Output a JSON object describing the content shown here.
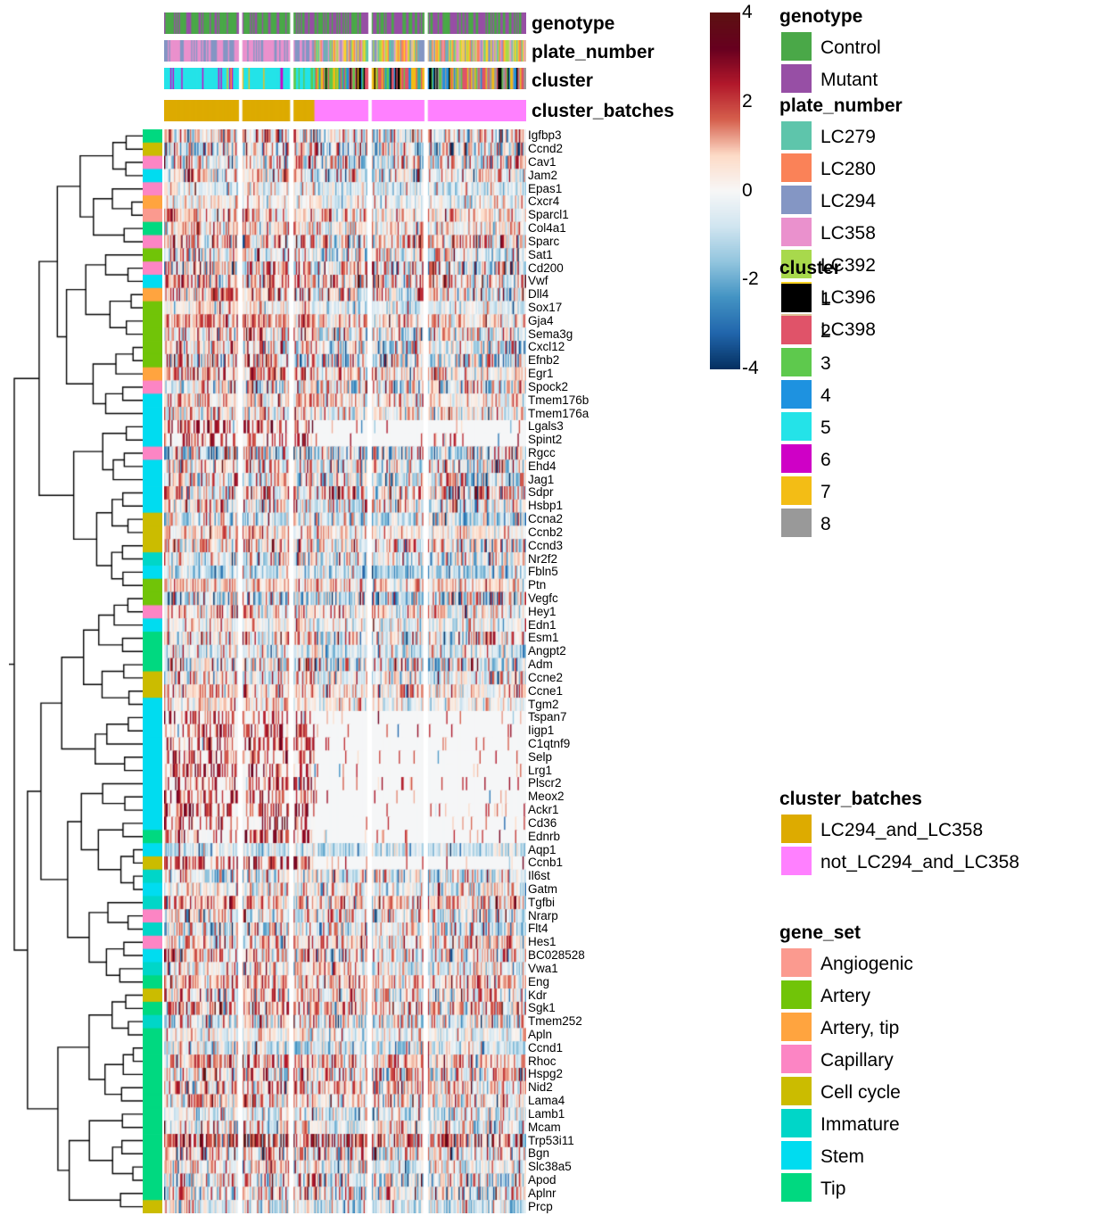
{
  "column_annotations": [
    {
      "name": "genotype",
      "label": "genotype"
    },
    {
      "name": "plate_number",
      "label": "plate_number"
    },
    {
      "name": "cluster",
      "label": "cluster"
    },
    {
      "name": "cluster_batches",
      "label": "cluster_batches"
    }
  ],
  "colorbar": {
    "ticks": [
      "4",
      "2",
      "0",
      "-2",
      "-4"
    ],
    "values": [
      4,
      2,
      0,
      -2,
      -4
    ],
    "low_color": "#053061",
    "mid_color": "#ffffff",
    "high_color": "#5c1111"
  },
  "legends": [
    {
      "title": "genotype",
      "items": [
        {
          "label": "Control",
          "color": "#4aa848"
        },
        {
          "label": "Mutant",
          "color": "#974fa5"
        }
      ]
    },
    {
      "title": "plate_number",
      "items": [
        {
          "label": "LC279",
          "color": "#5ec5ab"
        },
        {
          "label": "LC280",
          "color": "#fa8258"
        },
        {
          "label": "LC294",
          "color": "#8496c4"
        },
        {
          "label": "LC358",
          "color": "#ea91cd"
        },
        {
          "label": "LC392",
          "color": "#a8d94c"
        },
        {
          "label": "LC396",
          "color": "#ffd324"
        },
        {
          "label": "LC398",
          "color": "#e0c296"
        }
      ]
    },
    {
      "title": "cluster",
      "items": [
        {
          "label": "1",
          "color": "#000000"
        },
        {
          "label": "2",
          "color": "#e05369"
        },
        {
          "label": "3",
          "color": "#5ec94d"
        },
        {
          "label": "4",
          "color": "#1e92e0"
        },
        {
          "label": "5",
          "color": "#24e3e8"
        },
        {
          "label": "6",
          "color": "#cf00c6"
        },
        {
          "label": "7",
          "color": "#f3bd15"
        },
        {
          "label": "8",
          "color": "#999999"
        }
      ]
    },
    {
      "title": "cluster_batches",
      "items": [
        {
          "label": "LC294_and_LC358",
          "color": "#ddab00"
        },
        {
          "label": "not_LC294_and_LC358",
          "color": "#ff80ff"
        }
      ]
    },
    {
      "title": "gene_set",
      "items": [
        {
          "label": "Angiogenic",
          "color": "#fb9a8f"
        },
        {
          "label": "Artery",
          "color": "#71c408"
        },
        {
          "label": "Artery, tip",
          "color": "#ffa43f"
        },
        {
          "label": "Capillary",
          "color": "#fc85c4"
        },
        {
          "label": "Cell cycle",
          "color": "#cbbc00"
        },
        {
          "label": "Immature",
          "color": "#00d6c8"
        },
        {
          "label": "Stem",
          "color": "#00dcf0"
        },
        {
          "label": "Tip",
          "color": "#00d980"
        }
      ]
    }
  ],
  "chart_data": {
    "type": "heatmap",
    "title": "",
    "xlabel": "",
    "ylabel": "",
    "zlim": [
      -4,
      4
    ],
    "n_rows": 82,
    "n_columns": 280,
    "column_splits": [
      60,
      38,
      60,
      42,
      80
    ],
    "row_labels": [
      "Igfbp3",
      "Ccnd2",
      "Cav1",
      "Jam2",
      "Epas1",
      "Cxcr4",
      "Sparcl1",
      "Col4a1",
      "Sparc",
      "Sat1",
      "Cd200",
      "Vwf",
      "Dll4",
      "Sox17",
      "Gja4",
      "Sema3g",
      "Cxcl12",
      "Efnb2",
      "Egr1",
      "Spock2",
      "Tmem176b",
      "Tmem176a",
      "Lgals3",
      "Spint2",
      "Rgcc",
      "Ehd4",
      "Jag1",
      "Sdpr",
      "Hsbp1",
      "Ccna2",
      "Ccnb2",
      "Ccnd3",
      "Nr2f2",
      "Fbln5",
      "Ptn",
      "Vegfc",
      "Hey1",
      "Edn1",
      "Esm1",
      "Angpt2",
      "Adm",
      "Ccne2",
      "Ccne1",
      "Tgm2",
      "Tspan7",
      "Iigp1",
      "C1qtnf9",
      "Selp",
      "Lrg1",
      "Plscr2",
      "Meox2",
      "Ackr1",
      "Cd36",
      "Ednrb",
      "Aqp1",
      "Ccnb1",
      "Il6st",
      "Gatm",
      "Tgfbi",
      "Nrarp",
      "Flt4",
      "Hes1",
      "BC028528",
      "Vwa1",
      "Eng",
      "Kdr",
      "Sgk1",
      "Tmem252",
      "Apln",
      "Ccnd1",
      "Rhoc",
      "Hspg2",
      "Nid2",
      "Lama4",
      "Lamb1",
      "Mcam",
      "Trp53i11",
      "Bgn",
      "Slc38a5",
      "Apod",
      "Aplnr",
      "Prcp"
    ],
    "row_gene_set": [
      "Tip",
      "Cell cycle",
      "Capillary",
      "Stem",
      "Capillary",
      "Artery, tip",
      "Angiogenic",
      "Tip",
      "Capillary",
      "Artery",
      "Capillary",
      "Stem",
      "Artery, tip",
      "Artery",
      "Artery",
      "Artery",
      "Artery",
      "Artery",
      "Artery, tip",
      "Capillary",
      "Stem",
      "Stem",
      "Stem",
      "Stem",
      "Capillary",
      "Stem",
      "Stem",
      "Stem",
      "Stem",
      "Cell cycle",
      "Cell cycle",
      "Cell cycle",
      "Immature",
      "Stem",
      "Artery",
      "Artery",
      "Capillary",
      "Stem",
      "Tip",
      "Tip",
      "Tip",
      "Cell cycle",
      "Cell cycle",
      "Stem",
      "Stem",
      "Stem",
      "Stem",
      "Stem",
      "Stem",
      "Stem",
      "Stem",
      "Stem",
      "Stem",
      "Tip",
      "Stem",
      "Cell cycle",
      "Immature",
      "Stem",
      "Immature",
      "Capillary",
      "Immature",
      "Capillary",
      "Stem",
      "Immature",
      "Tip",
      "Cell cycle",
      "Tip",
      "Immature",
      "Tip",
      "Tip",
      "Tip",
      "Tip",
      "Tip",
      "Tip",
      "Tip",
      "Tip",
      "Tip",
      "Tip",
      "Tip",
      "Tip",
      "Tip",
      "Cell cycle"
    ],
    "column_genotype_categories": [
      "Control",
      "Mutant"
    ],
    "column_plate_categories": [
      "LC279",
      "LC280",
      "LC294",
      "LC358",
      "LC392",
      "LC396",
      "LC398"
    ],
    "column_cluster_categories": [
      "1",
      "2",
      "3",
      "4",
      "5",
      "6",
      "7",
      "8"
    ],
    "column_batch_categories": [
      "LC294_and_LC358",
      "not_LC294_and_LC358"
    ]
  }
}
